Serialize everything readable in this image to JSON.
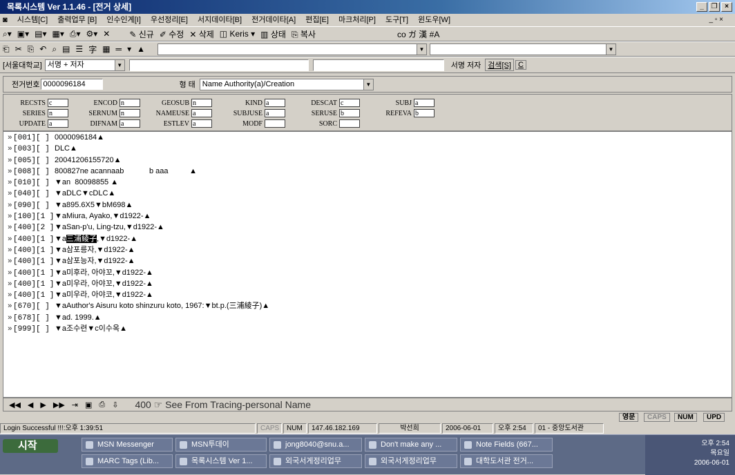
{
  "window": {
    "title": "목록시스템 Ver 1.1.46 - [전거 상세]"
  },
  "menu": [
    "시스템[C]",
    "출력업무 [B]",
    "인수인계[I]",
    "우선정리[E]",
    "서지데이타[B]",
    "전거데이타[A]",
    "편집[E]",
    "마크처리[P]",
    "도구[T]",
    "윈도우[W]"
  ],
  "toolbar1": {
    "new": "신규",
    "edit": "수정",
    "delete": "삭제",
    "keris": "Keris",
    "status": "상태",
    "copy": "복사",
    "icons_right": "ᴄᴏ ガ 漢 #A"
  },
  "search": {
    "library": "[서울대학교]",
    "field": "서명 + 저자",
    "scope": "서명 저자",
    "search_btn": "검색[S]",
    "c_btn": "C"
  },
  "record": {
    "id_label": "전거번호",
    "id_value": "0000096184",
    "type_label": "형 태",
    "type_value": "Name Authority(a)/Creation"
  },
  "fixed": [
    {
      "l": "RECSTS",
      "v": "c"
    },
    {
      "l": "ENCOD",
      "v": "n"
    },
    {
      "l": "GEOSUB",
      "v": "n"
    },
    {
      "l": "KIND",
      "v": "a"
    },
    {
      "l": "DESCAT",
      "v": "c"
    },
    {
      "l": "SUBJ",
      "v": "a"
    },
    {
      "l": "SERIES",
      "v": "n"
    },
    {
      "l": "SERNUM",
      "v": "n"
    },
    {
      "l": "NAMEUSE",
      "v": "a"
    },
    {
      "l": "SUBJUSE",
      "v": "a"
    },
    {
      "l": "SERUSE",
      "v": "b"
    },
    {
      "l": "REFEVA",
      "v": "b"
    },
    {
      "l": "UPDATE",
      "v": "a"
    },
    {
      "l": "DIFNAM",
      "v": "a"
    },
    {
      "l": "ESTLEV",
      "v": "a"
    },
    {
      "l": "MODF",
      "v": ""
    },
    {
      "l": "SORC",
      "v": ""
    }
  ],
  "fields": [
    {
      "tag": "[001][  ]",
      "val": "0000096184▲"
    },
    {
      "tag": "[003][  ]",
      "val": "DLC▲"
    },
    {
      "tag": "[005][  ]",
      "val": "20041206155720▲"
    },
    {
      "tag": "[008][  ]",
      "val": "800827ne acannaab            b aaa          ▲"
    },
    {
      "tag": "[010][  ]",
      "val": "▼an  80098855 ▲"
    },
    {
      "tag": "[040][  ]",
      "val": "▼aDLC▼cDLC▲"
    },
    {
      "tag": "[090][  ]",
      "val": "▼a895.6X5▼bM698▲"
    },
    {
      "tag": "[100][1 ]",
      "val": "▼aMiura, Ayako,▼d1922-▲"
    },
    {
      "tag": "[400][2 ]",
      "val": "▼aSan-p'u, Ling-tzu,▼d1922-▲"
    },
    {
      "tag": "[400][1 ]",
      "val_pre": "▼a",
      "val_hl": "三浦綾子",
      "val_post": ",▼d1922-▲"
    },
    {
      "tag": "[400][1 ]",
      "val": "▼a삼포릉자,▼d1922-▲"
    },
    {
      "tag": "[400][1 ]",
      "val": "▼a삼포능자,▼d1922-▲"
    },
    {
      "tag": "[400][1 ]",
      "val": "▼a미후라, 아야꼬,▼d1922-▲"
    },
    {
      "tag": "[400][1 ]",
      "val": "▼a미우라, 아야꼬,▼d1922-▲"
    },
    {
      "tag": "[400][1 ]",
      "val": "▼a미우라, 아야코,▼d1922-▲"
    },
    {
      "tag": "[670][  ]",
      "val": "▼aAuthor's Aisuru koto shinzuru koto, 1967:▼bt.p.(三浦綾子)▲"
    },
    {
      "tag": "[678][  ]",
      "val": "▼ad. 1999.▲"
    },
    {
      "tag": "[999][  ]",
      "val": "▼a조수련▼c이수옥▲"
    }
  ],
  "nav": {
    "msg": "400 ☞ See From Tracing-personal Name",
    "mini": [
      "영문",
      "CAPS",
      "NUM",
      "UPD"
    ]
  },
  "status": [
    "Login Successful !!!:오후 1:39:51",
    "CAPS",
    "NUM",
    "147.46.182.169",
    "박선희",
    "2006-06-01",
    "오후 2:54",
    "01 - 중앙도서관"
  ],
  "taskbar": {
    "start": "시작",
    "buttons": [
      "MSN Messenger",
      "MSN투데이",
      "jong8040@snu.a...",
      "Don't make any ...",
      "Note Fields (667...",
      "MARC Tags (Lib...",
      "목록시스템 Ver 1...",
      "외국서게정리업무",
      "외국서게정리업무",
      "대학도서관 전거..."
    ],
    "clock": "오후 2:54",
    "day": "목요일",
    "date": "2006-06-01"
  }
}
